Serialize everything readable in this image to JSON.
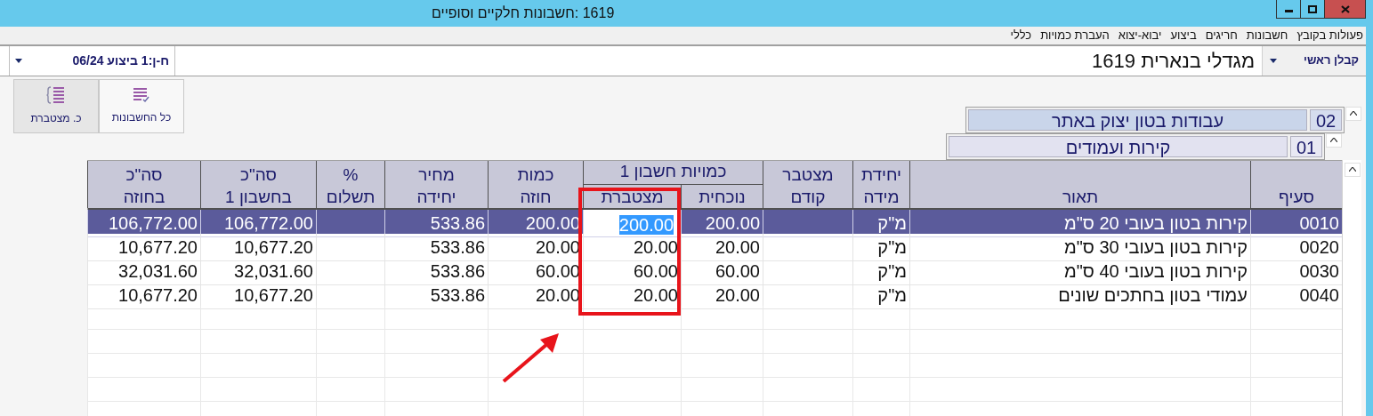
{
  "window": {
    "title": "1619 :חשבונות חלקיים וסופיים"
  },
  "menu": [
    "פעולות בקובץ",
    "חשבונות",
    "חריגים",
    "ביצוע",
    "יבוא-יצוא",
    "העברת כמויות",
    "כללי"
  ],
  "toolbar": {
    "role_label": "קבלן ראשי",
    "project": "מגדלי בנארית 1619",
    "bill": "ח-ן:1 ביצוע 06/24"
  },
  "view_buttons": [
    {
      "label": "כל החשבונות",
      "selected": false
    },
    {
      "label": "כ. מצטברת",
      "selected": true
    }
  ],
  "breadcrumbs": [
    {
      "code": "02",
      "label": "עבודות בטון יצוק באתר",
      "children": [
        {
          "code": "01",
          "label": "קירות ועמודים"
        }
      ]
    }
  ],
  "table": {
    "header_group": {
      "label": "כמויות חשבון 1"
    },
    "columns": [
      {
        "lines": [
          "סעיף"
        ],
        "grouped": false
      },
      {
        "lines": [
          "תאור"
        ],
        "grouped": false
      },
      {
        "lines": [
          "יחידת",
          "מידה"
        ],
        "grouped": false
      },
      {
        "lines": [
          "מצטבר",
          "קודם"
        ],
        "grouped": false
      },
      {
        "lines": [
          "נוכחית"
        ],
        "grouped": true
      },
      {
        "lines": [
          "מצטברת"
        ],
        "grouped": true
      },
      {
        "lines": [
          "כמות",
          "חוזה"
        ],
        "grouped": false
      },
      {
        "lines": [
          "מחיר",
          "יחידה"
        ],
        "grouped": false
      },
      {
        "lines": [
          "%",
          "תשלום"
        ],
        "grouped": false
      },
      {
        "lines": [
          "סה\"כ",
          "בחשבון 1"
        ],
        "grouped": false
      },
      {
        "lines": [
          "סה\"כ",
          "בחוזה"
        ],
        "grouped": false
      }
    ],
    "rows": [
      {
        "selected": true,
        "cells": [
          "0010",
          "קירות בטון בעובי 20 ס\"מ",
          "מ\"ק",
          null,
          "200.00",
          {
            "text": "200.00",
            "editing": true
          },
          "200.00",
          "533.86",
          null,
          "106,772.00",
          "106,772.00"
        ]
      },
      {
        "selected": false,
        "cells": [
          "0020",
          "קירות בטון בעובי 30 ס\"מ",
          "מ\"ק",
          null,
          "20.00",
          "20.00",
          "20.00",
          "533.86",
          null,
          "10,677.20",
          "10,677.20"
        ]
      },
      {
        "selected": false,
        "cells": [
          "0030",
          "קירות בטון בעובי 40 ס\"מ",
          "מ\"ק",
          null,
          "60.00",
          "60.00",
          "60.00",
          "533.86",
          null,
          "32,031.60",
          "32,031.60"
        ]
      },
      {
        "selected": false,
        "cells": [
          "0040",
          "עמודי בטון בחתכים שונים",
          "מ\"ק",
          null,
          "20.00",
          "20.00",
          "20.00",
          "533.86",
          null,
          "10,677.20",
          "10,677.20"
        ]
      }
    ]
  },
  "highlight_box": {
    "color": "#e8141b"
  },
  "pointer_arrow": {
    "color": "#e8141b"
  }
}
